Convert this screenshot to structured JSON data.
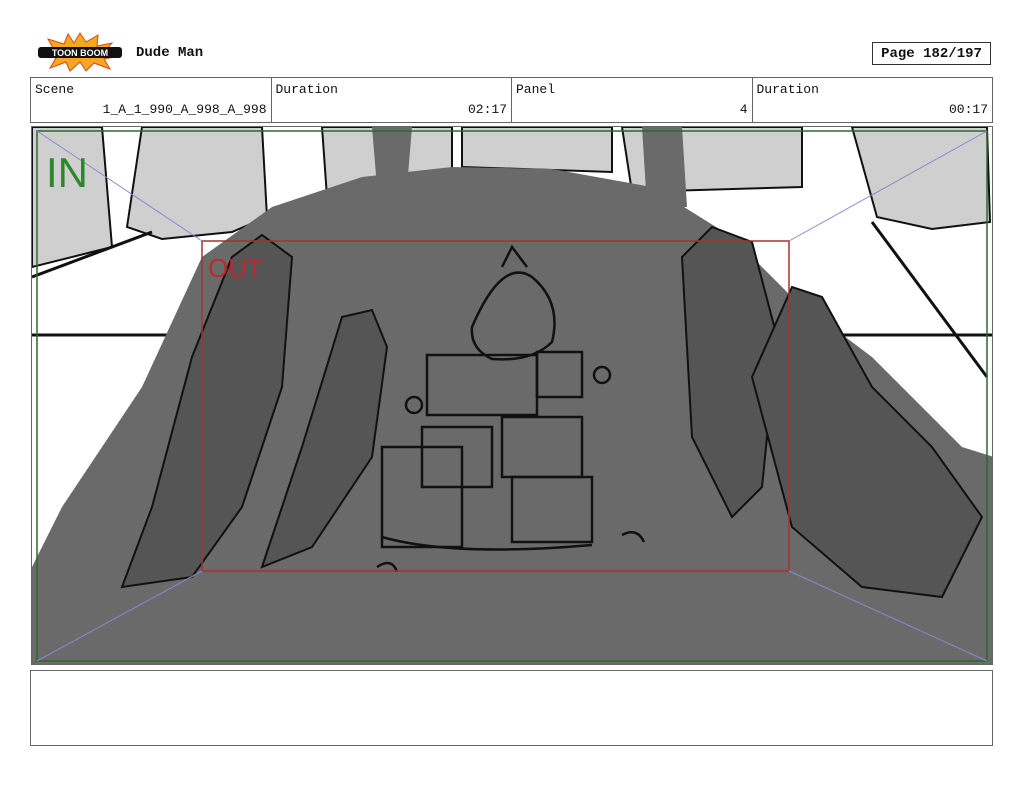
{
  "header": {
    "logo_text": "TOON BOOM",
    "project_title": "Dude Man",
    "page": "Page 182/197"
  },
  "info": {
    "scene_label": "Scene",
    "scene_value": "1_A_1_990_A_998_A_998",
    "duration_label": "Duration",
    "duration_value": "02:17",
    "panel_label": "Panel",
    "panel_value": "4",
    "panel_duration_label": "Duration",
    "panel_duration_value": "00:17"
  },
  "frame": {
    "in_label": "IN",
    "out_label": "OUT",
    "in_color": "#2a8a2a",
    "out_color": "#c0282a"
  },
  "notes": ""
}
